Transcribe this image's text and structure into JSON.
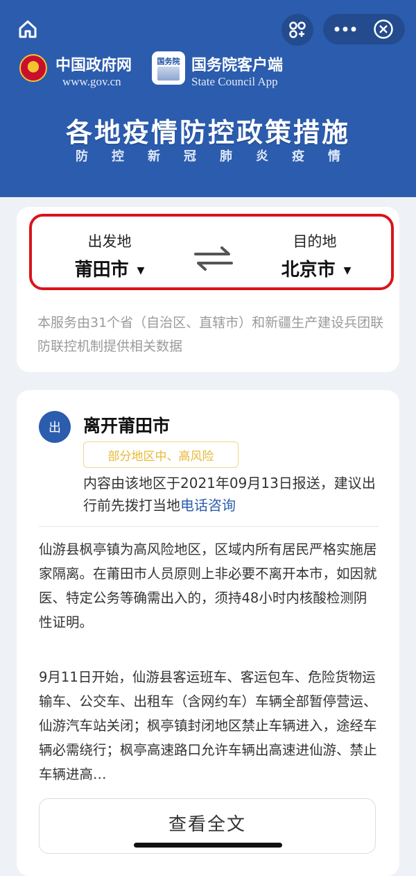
{
  "header": {
    "gov_name": "中国政府网",
    "gov_url": "www.gov.cn",
    "app_icon_text": "国务院",
    "app_name": "国务院客户端",
    "app_name_en": "State Council App",
    "title": "各地疫情防控政策措施",
    "subtitle": "防控新冠肺炎疫情"
  },
  "icons": {
    "home": "home-icon",
    "scan": "scan-icon",
    "more": "more-icon",
    "close": "close-icon",
    "swap": "swap-icon"
  },
  "route": {
    "from_label": "出发地",
    "from_city": "莆田市",
    "to_label": "目的地",
    "to_city": "北京市",
    "caret": "▼",
    "notice": "本服务由31个省（自治区、直辖市）和新疆生产建设兵团联防联控机制提供相关数据"
  },
  "departure": {
    "badge": "出",
    "title": "离开莆田市",
    "risk_tag": "部分地区中、高风险",
    "report_text": "内容由该地区于2021年09月13日报送，建议出行前先拨打当地",
    "phone_link": "电话咨询",
    "paragraph1": "仙游县枫亭镇为高风险地区，区域内所有居民严格实施居家隔离。在莆田市人员原则上非必要不离开本市，如因就医、特定公务等确需出入的，须持48小时内核酸检测阴性证明。",
    "paragraph2": "9月11日开始，仙游县客运班车、客运包车、危险货物运输车、公交车、出租车（含网约车）车辆全部暂停营运、仙游汽车站关闭；枫亭镇封闭地区禁止车辆进入，途经车辆必需绕行；枫亭高速路口允许车辆出高速进仙游、禁止车辆进高…",
    "view_full": "查看全文"
  },
  "colors": {
    "header_blue": "#2b5cae",
    "highlight_red": "#d9141c",
    "risk_yellow": "#e8b935",
    "link_blue": "#2b5cae"
  }
}
